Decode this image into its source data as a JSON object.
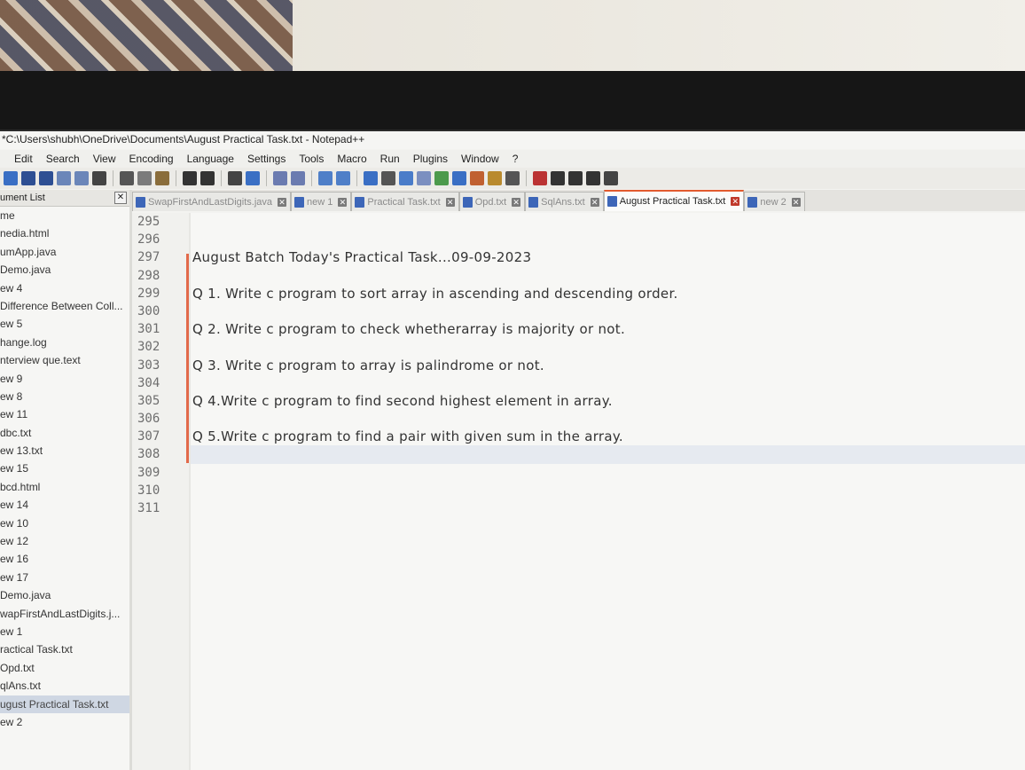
{
  "window": {
    "title": "*C:\\Users\\shubh\\OneDrive\\Documents\\August Practical Task.txt - Notepad++"
  },
  "menu": [
    "Edit",
    "Search",
    "View",
    "Encoding",
    "Language",
    "Settings",
    "Tools",
    "Macro",
    "Run",
    "Plugins",
    "Window",
    "?"
  ],
  "doclist": {
    "header": "ument List",
    "close": "✕",
    "items": [
      "me",
      "nedia.html",
      "umApp.java",
      "Demo.java",
      "ew 4",
      "Difference Between Coll...",
      "ew 5",
      "hange.log",
      "nterview que.text",
      "ew 9",
      "ew 8",
      "ew 11",
      "dbc.txt",
      "ew 13.txt",
      "ew 15",
      "bcd.html",
      "ew 14",
      "ew 10",
      "ew 12",
      "ew 16",
      "ew 17",
      "Demo.java",
      "wapFirstAndLastDigits.j...",
      "ew 1",
      "ractical Task.txt",
      "Opd.txt",
      "qlAns.txt",
      "ugust Practical Task.txt",
      "ew 2"
    ],
    "active_index": 27
  },
  "tabs": [
    {
      "label": "SwapFirstAndLastDigits.java",
      "active": false
    },
    {
      "label": "new 1",
      "active": false
    },
    {
      "label": "Practical Task.txt",
      "active": false
    },
    {
      "label": "Opd.txt",
      "active": false
    },
    {
      "label": "SqlAns.txt",
      "active": false
    },
    {
      "label": "August Practical Task.txt",
      "active": true
    },
    {
      "label": "new 2",
      "active": false
    }
  ],
  "tab_close": "✕",
  "editor": {
    "line_numbers": [
      "295",
      "296",
      "297",
      "298",
      "299",
      "300",
      "301",
      "302",
      "303",
      "304",
      "305",
      "306",
      "307",
      "308",
      "309",
      "310",
      "311"
    ],
    "lines": [
      "",
      "",
      "August  Batch Today's Practical Task...09-09-2023",
      "",
      "Q 1. Write c program to sort array in ascending and descending order.",
      "",
      "Q 2. Write c program to check whetherarray is majority or not.",
      "",
      "Q 3. Write c program to array is palindrome or not.",
      "",
      "Q 4.Write c program to find second highest element in array.",
      "",
      "Q 5.Write c program to find a pair with given sum in the array.",
      "",
      "",
      "",
      ""
    ],
    "current_line_index": 13
  }
}
